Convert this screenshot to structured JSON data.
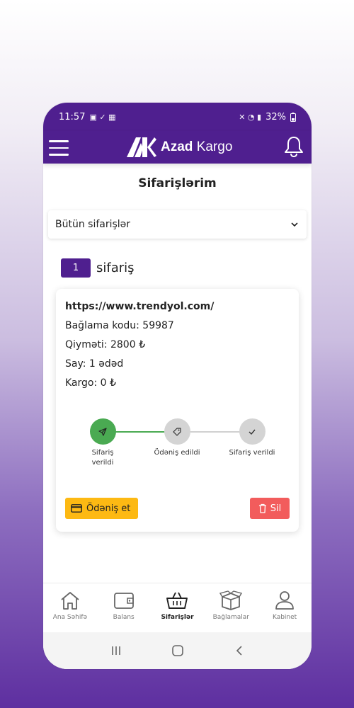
{
  "status_bar": {
    "time": "11:57",
    "battery": "32%"
  },
  "app_bar": {
    "logo_brand": "Azad",
    "logo_suffix": "Kargo"
  },
  "page": {
    "title": "Sifarişlərim"
  },
  "filter": {
    "selected": "Bütün sifarişlər"
  },
  "orders_count": {
    "count": "1",
    "label": "sifariş"
  },
  "order": {
    "url": "https://www.trendyol.com/",
    "package_code": "Bağlama kodu: 59987",
    "price": "Qiyməti: 2800 ₺",
    "quantity": "Say: 1 ədəd",
    "cargo": "Kargo: 0 ₺",
    "steps": [
      {
        "label": "Sifariş verildi",
        "done": true
      },
      {
        "label": "Ödəniş edildi",
        "done": false
      },
      {
        "label": "Sifariş verildi",
        "done": false
      }
    ],
    "pay_label": "Ödəniş et",
    "delete_label": "Sil"
  },
  "bottom_nav": [
    {
      "label": "Ana Səhifə",
      "icon": "home-icon"
    },
    {
      "label": "Balans",
      "icon": "wallet-icon"
    },
    {
      "label": "Sifarişlər",
      "icon": "basket-icon",
      "active": true
    },
    {
      "label": "Bağlamalar",
      "icon": "box-icon"
    },
    {
      "label": "Kabinet",
      "icon": "user-icon"
    }
  ],
  "colors": {
    "primary": "#4f1f8f",
    "success": "#4aaa52",
    "pay": "#fdb913",
    "danger": "#f25c5c"
  }
}
